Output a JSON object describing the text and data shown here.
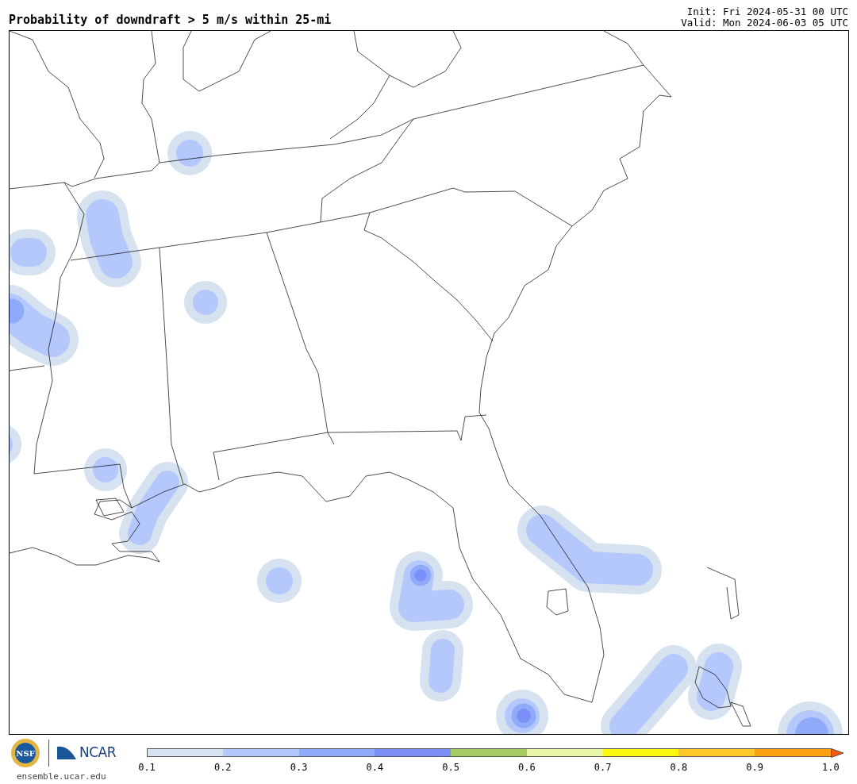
{
  "title": "Probability of downdraft > 5 m/s within 25-mi",
  "init": "Init: Fri 2024-05-31 00 UTC",
  "valid": "Valid: Mon 2024-06-03 05 UTC",
  "logos": {
    "nsf": "NSF",
    "ncar": "NCAR",
    "url": "ensemble.ucar.edu"
  },
  "colorbar": {
    "segments": [
      {
        "color": "#d6e2f0"
      },
      {
        "color": "#b4c8fc"
      },
      {
        "color": "#8eaaf8"
      },
      {
        "color": "#7c8ef7"
      },
      {
        "color": "#a5ca62"
      },
      {
        "color": "#e6f5a6"
      },
      {
        "color": "#fcf70e"
      },
      {
        "color": "#fcc928"
      },
      {
        "color": "#fba00f"
      }
    ],
    "extend_arrow": {
      "color": "#f25810"
    },
    "ticks": [
      "0.1",
      "0.2",
      "0.3",
      "0.4",
      "0.5",
      "0.6",
      "0.7",
      "0.8",
      "0.9",
      "1.0"
    ]
  }
}
